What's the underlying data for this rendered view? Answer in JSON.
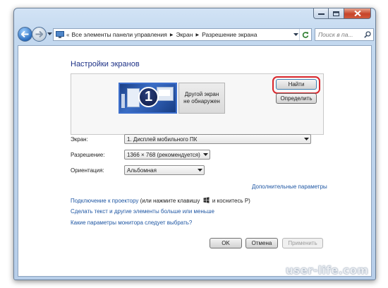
{
  "address_bar": {
    "breadcrumbs": [
      "Все элементы панели управления",
      "Экран",
      "Разрешение экрана"
    ],
    "overflow": "«"
  },
  "search": {
    "placeholder": "Поиск в па..."
  },
  "page": {
    "title": "Настройки экранов"
  },
  "preview": {
    "monitor_1_number": "1",
    "monitor_2_text_line1": "Другой экран",
    "monitor_2_text_line2": "не обнаружен",
    "find_button": "Найти",
    "identify_button": "Определить"
  },
  "form": {
    "display_label": "Экран:",
    "display_value": "1. Дисплей мобильного ПК",
    "resolution_label": "Разрешение:",
    "resolution_value": "1366 × 768 (рекомендуется)",
    "orientation_label": "Ориентация:",
    "orientation_value": "Альбомная",
    "advanced_link": "Дополнительные параметры"
  },
  "links": {
    "projector_link": "Подключение к проектору",
    "projector_hint_before": "(или нажмите клавишу",
    "projector_hint_after": "и коснитесь P)",
    "text_size_link": "Сделать текст и другие элементы больше или меньше",
    "monitor_params_link": "Какие параметры монитора следует выбрать?"
  },
  "footer": {
    "ok": "OK",
    "cancel": "Отмена",
    "apply": "Применить"
  },
  "watermark": "user-life.com",
  "colors": {
    "accent_link": "#1e56a3",
    "title": "#1e3287",
    "highlight_ring": "#d9262b"
  }
}
